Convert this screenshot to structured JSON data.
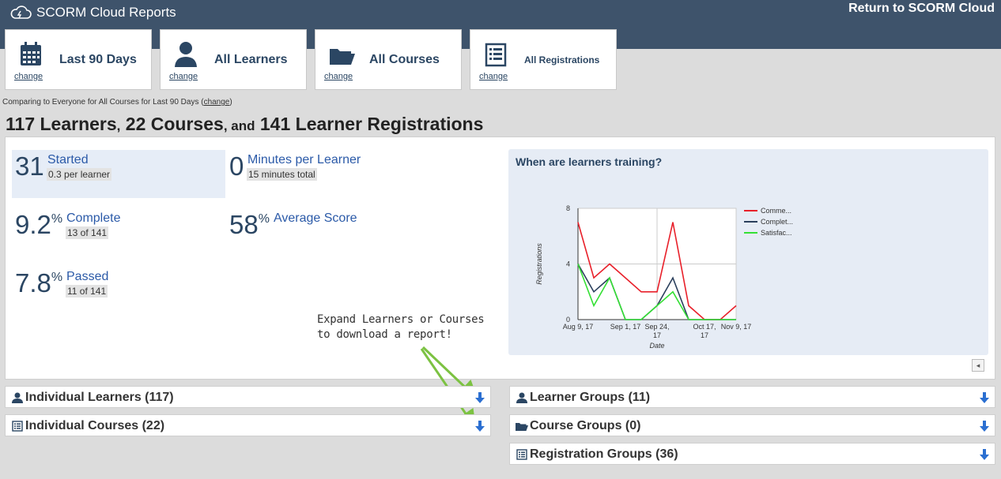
{
  "header": {
    "app_title": "SCORM Cloud Reports",
    "return_link": "Return to SCORM Cloud",
    "brand_icon": "cloud-icon"
  },
  "filters": [
    {
      "label": "Last 90 Days",
      "change": "change",
      "icon": "calendar-icon"
    },
    {
      "label": "All Learners",
      "change": "change",
      "icon": "person-icon"
    },
    {
      "label": "All Courses",
      "change": "change",
      "icon": "folder-icon"
    },
    {
      "label": "All Registrations",
      "change": "change",
      "icon": "list-icon"
    }
  ],
  "comparison": {
    "text": "Comparing to Everyone for All Courses for Last 90 Days (",
    "link": "change",
    "close": ")"
  },
  "headline": {
    "learners": "117 Learners",
    "sep1": ",",
    "courses": "22 Courses",
    "sep2": ", and",
    "registrations": "141 Learner Registrations"
  },
  "stats": {
    "started": {
      "value": "31",
      "label": "Started",
      "sub": "0.3 per learner"
    },
    "minutes": {
      "value": "0",
      "label": "Minutes per Learner",
      "sub": "15 minutes total"
    },
    "complete": {
      "value": "9.2",
      "unit": "%",
      "label": "Complete",
      "sub": "13 of 141"
    },
    "score": {
      "value": "58",
      "unit": "%",
      "label": "Average Score"
    },
    "passed": {
      "value": "7.8",
      "unit": "%",
      "label": "Passed",
      "sub": "11 of 141"
    }
  },
  "chart_data": {
    "type": "line",
    "title": "When are learners training?",
    "xlabel": "Date",
    "ylabel": "Registrations",
    "ylim": [
      0,
      8
    ],
    "y_ticks": [
      0,
      4,
      8
    ],
    "x_ticks": [
      {
        "label": "Aug 9, 17",
        "index": 0
      },
      {
        "label": "Sep 1, 17",
        "index": 3
      },
      {
        "label": "Sep 24, 17",
        "index": 5
      },
      {
        "label": "Oct 17, 17",
        "index": 8
      },
      {
        "label": "Nov 9, 17",
        "index": 10
      }
    ],
    "x_count": 11,
    "grid": true,
    "legend_position": "right",
    "series": [
      {
        "name": "Comme...",
        "color": "#e8202a",
        "values": [
          7,
          3,
          4,
          3,
          2,
          2,
          7,
          1,
          0,
          0,
          1
        ]
      },
      {
        "name": "Complet...",
        "color": "#2b3f5c",
        "values": [
          4,
          2,
          3,
          0,
          0,
          1,
          3,
          0,
          0,
          0,
          0
        ]
      },
      {
        "name": "Satisfac...",
        "color": "#34e034",
        "values": [
          4,
          1,
          3,
          0,
          0,
          1,
          2,
          0,
          0,
          0,
          0
        ]
      }
    ]
  },
  "annotation": {
    "line1": "Expand Learners or Courses",
    "line2": "to download a report!",
    "color": "#7cc242"
  },
  "sections": [
    {
      "title": "Individual Learners (117)",
      "icon": "person-icon"
    },
    {
      "title": "Individual Courses (22)",
      "icon": "list-icon"
    },
    {
      "title": "Learner Groups (11)",
      "icon": "person-icon"
    },
    {
      "title": "Course Groups (0)",
      "icon": "folder-icon"
    },
    {
      "title": "Registration Groups (36)",
      "icon": "list-icon"
    }
  ],
  "collapse_control": "◂"
}
